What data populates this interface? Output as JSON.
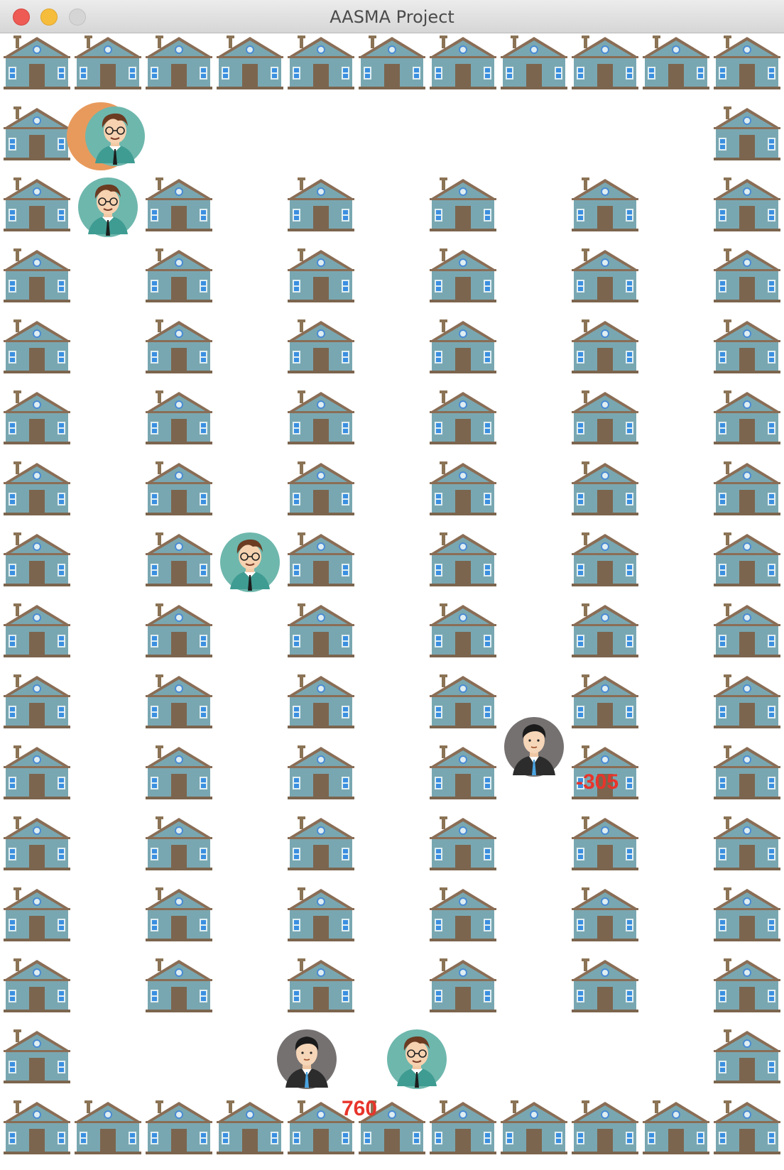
{
  "window": {
    "title": "AASMA Project",
    "controls": [
      "close-icon",
      "minimize-icon",
      "zoom-icon"
    ],
    "colors": {
      "close": "#ee5b55",
      "minimize": "#f6bd3c",
      "zoom": "#d5d5d5"
    }
  },
  "map": {
    "legend": {
      "#": "house",
      ".": "street"
    },
    "rows": [
      "###########",
      "#.........#",
      "#.#.#.#.#.#",
      "#.#.#.#.#.#",
      "#.#.#.#.#.#",
      "#.#.#.#.#.#",
      "#.#.#.#.#.#",
      "#.#.#.#.#.#",
      "#.#.#.#.#.#",
      "#.#.#.#.#.#",
      "#.#.#.#.#.#",
      "#.#.#.#.#.#",
      "#.#.#.#.#.#",
      "#.#.#.#.#.#",
      "#.........#",
      "###########"
    ]
  },
  "agents": [
    {
      "type": "glasses-man",
      "col": 1.6,
      "row": 1,
      "shirt": "#5fb3a8",
      "highlight": true
    },
    {
      "type": "glasses-man",
      "col": 1.5,
      "row": 2
    },
    {
      "type": "glasses-man",
      "col": 3.5,
      "row": 7
    },
    {
      "type": "glasses-man",
      "col": 5.85,
      "row": 14
    },
    {
      "type": "businessman",
      "col": 7.5,
      "row": 9.6
    },
    {
      "type": "businessman",
      "col": 4.3,
      "row": 14
    }
  ],
  "scores": [
    {
      "text": "-305",
      "col": 8.35,
      "row": 10.35
    },
    {
      "text": "760",
      "col": 5.05,
      "row": 14.95
    }
  ],
  "colors": {
    "score": "#e8342b",
    "highlight": "#e89a5c"
  }
}
